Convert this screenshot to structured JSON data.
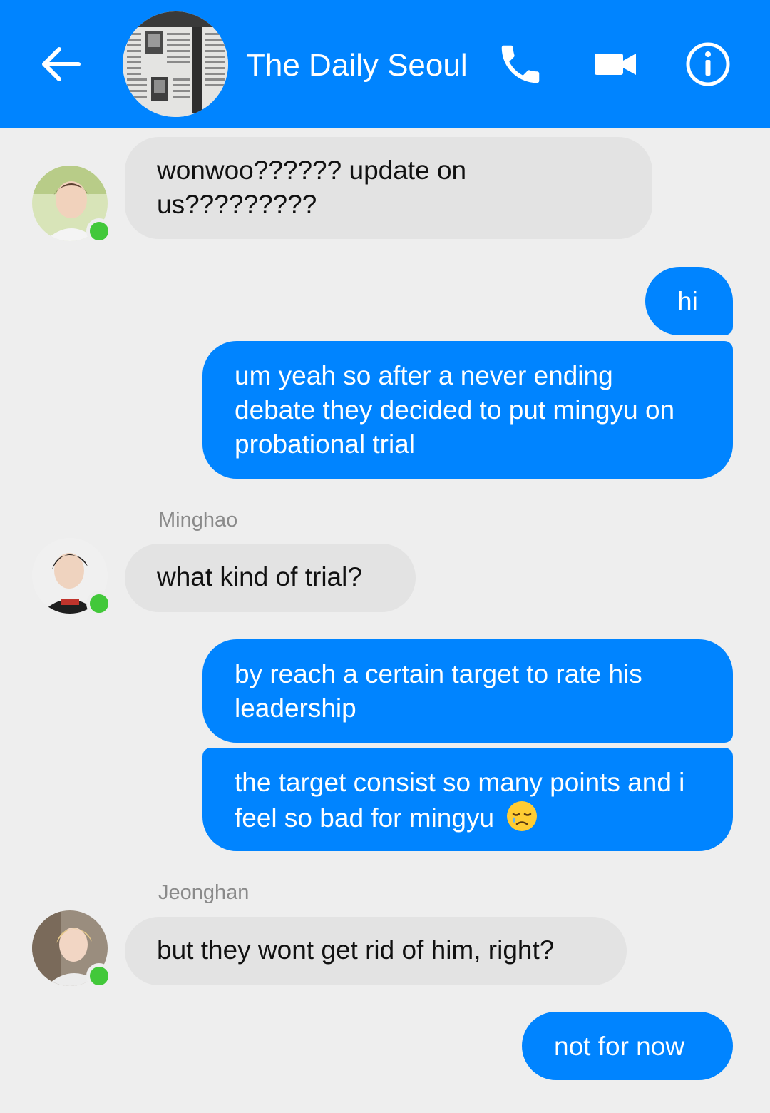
{
  "header": {
    "title": "The Daily Seoul",
    "back_icon": "arrow-left-icon",
    "call_icon": "phone-icon",
    "video_icon": "video-camera-icon",
    "info_icon": "info-icon",
    "background_color": "#0084ff"
  },
  "messages": [
    {
      "direction": "incoming",
      "sender": "",
      "text": "wonwoo?????? update on us?????????"
    },
    {
      "direction": "outgoing",
      "text": "hi"
    },
    {
      "direction": "outgoing",
      "text": "um yeah so after a never ending debate they decided to put mingyu on probational trial"
    },
    {
      "direction": "incoming",
      "sender": "Minghao",
      "text": "what kind of trial?"
    },
    {
      "direction": "outgoing",
      "text": "by reach a certain target to rate his leadership"
    },
    {
      "direction": "outgoing",
      "text": "the target consist so many points and i feel so bad for mingyu",
      "emoji": "sad-tear-emoji"
    },
    {
      "direction": "incoming",
      "sender": "Jeonghan",
      "text": "but they wont get rid of him, right?"
    },
    {
      "direction": "outgoing",
      "text": "not for now"
    }
  ],
  "colors": {
    "outgoing_bubble": "#0084ff",
    "incoming_bubble": "#e3e3e3",
    "online_indicator": "#42c83a",
    "chat_background": "#eeeeee"
  }
}
